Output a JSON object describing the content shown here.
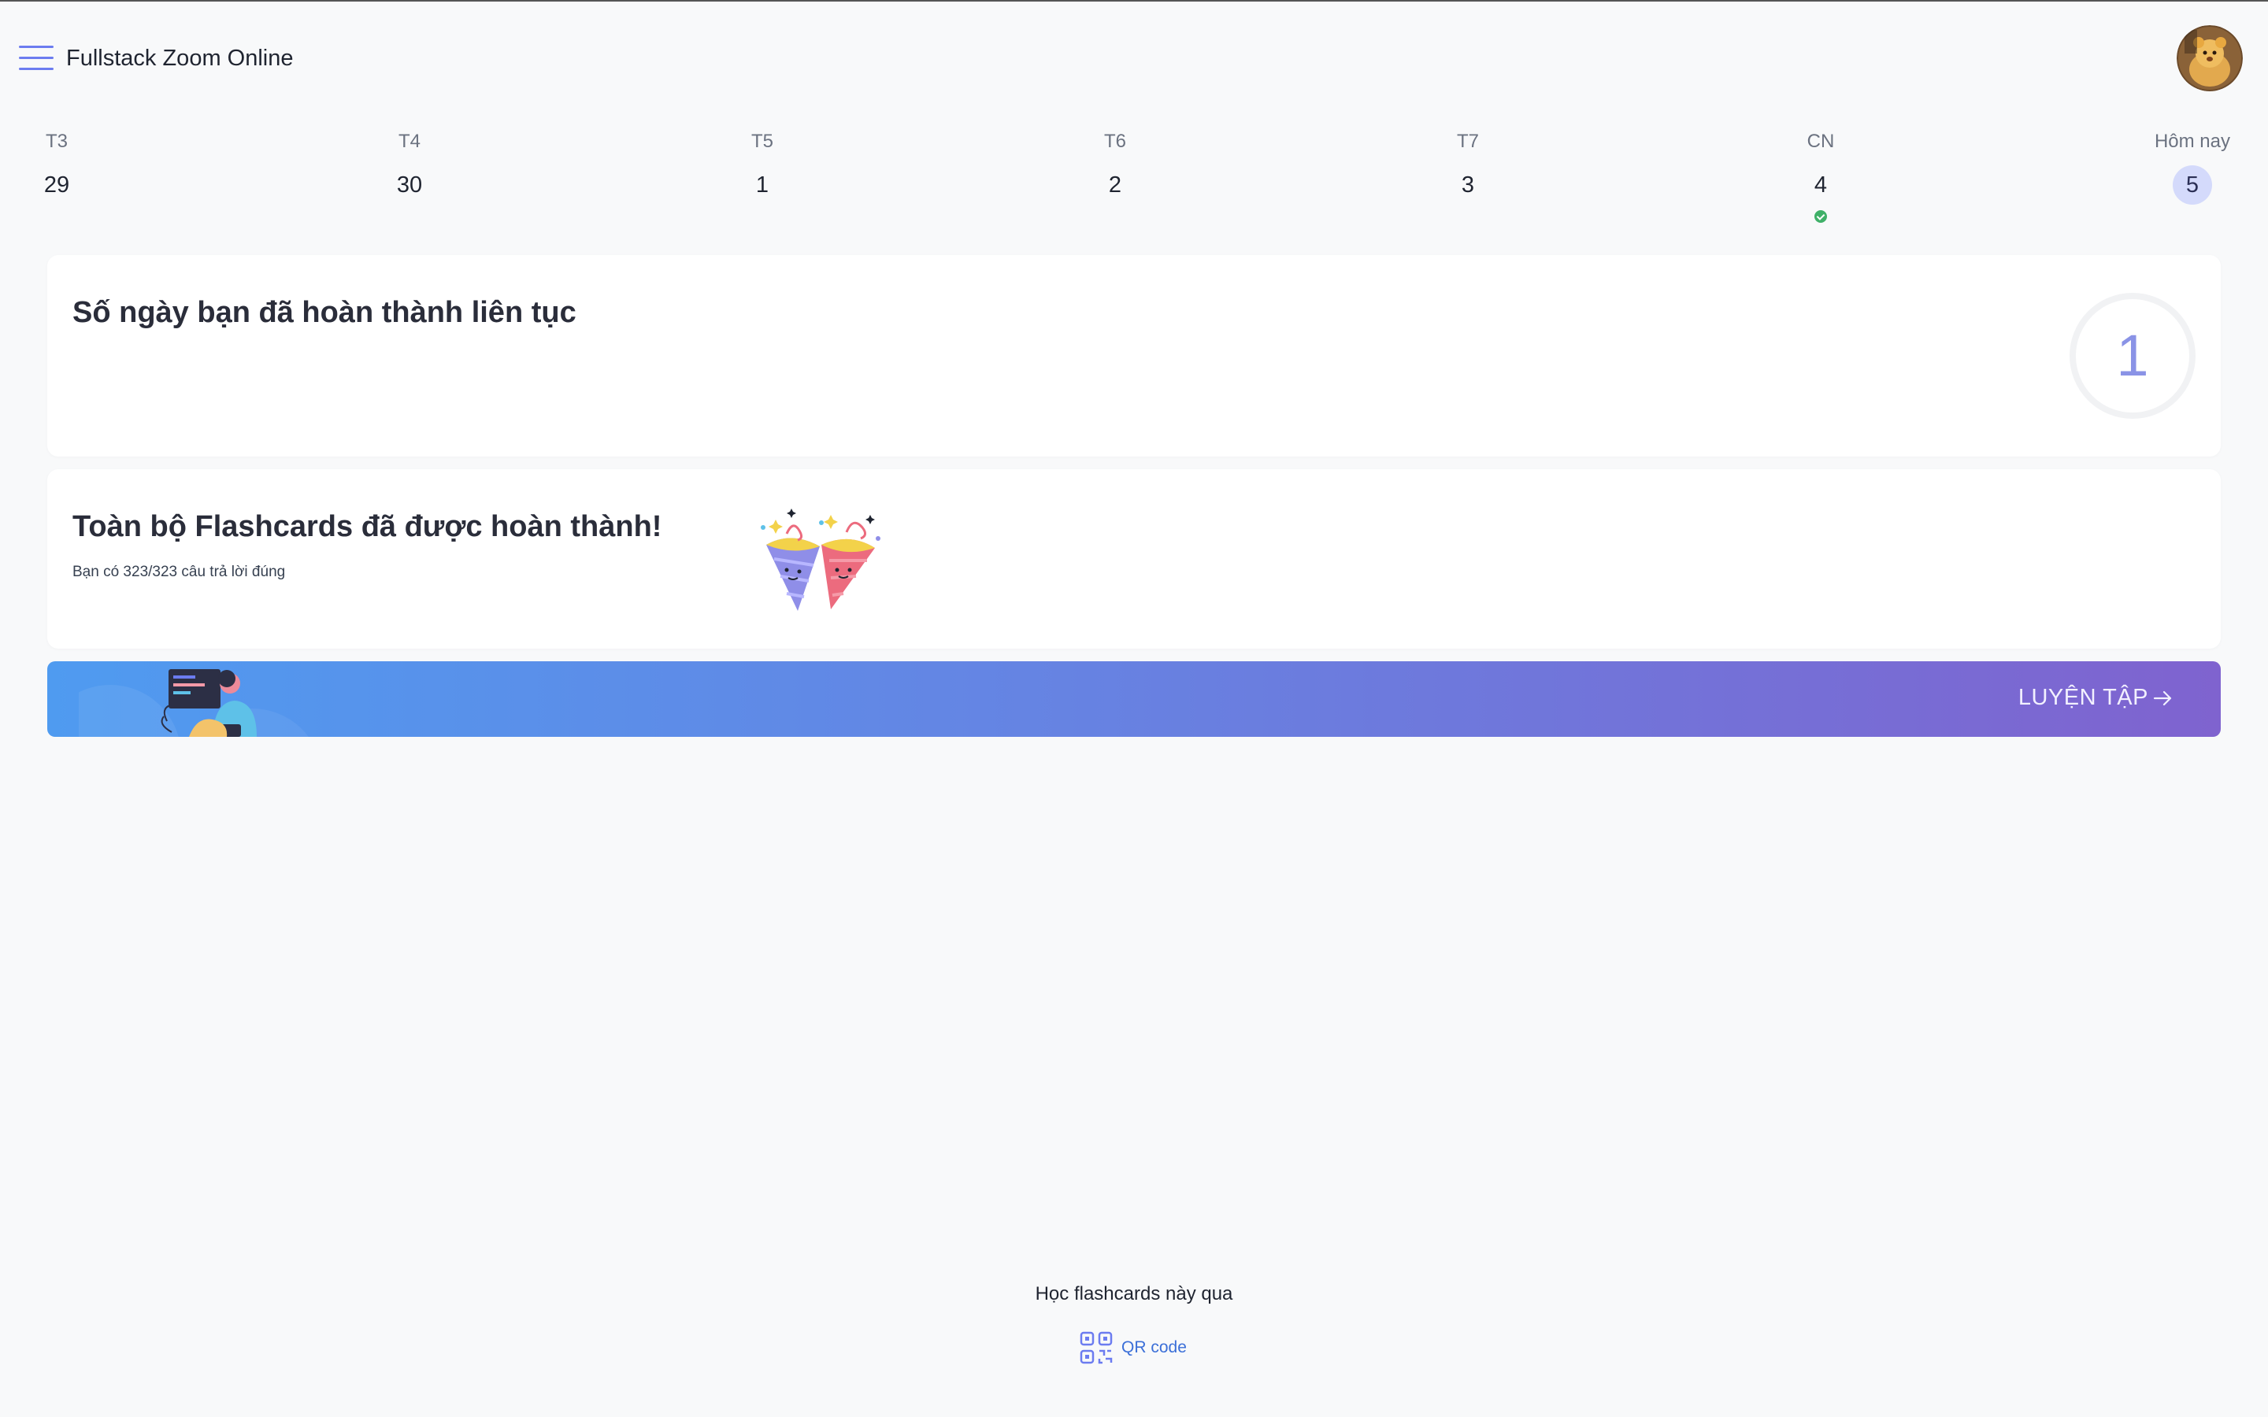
{
  "header": {
    "app_title": "Fullstack Zoom Online"
  },
  "week": [
    {
      "label": "T3",
      "date": "29",
      "done": false,
      "today": false
    },
    {
      "label": "T4",
      "date": "30",
      "done": false,
      "today": false
    },
    {
      "label": "T5",
      "date": "1",
      "done": false,
      "today": false
    },
    {
      "label": "T6",
      "date": "2",
      "done": false,
      "today": false
    },
    {
      "label": "T7",
      "date": "3",
      "done": false,
      "today": false
    },
    {
      "label": "CN",
      "date": "4",
      "done": true,
      "today": false
    },
    {
      "label": "Hôm nay",
      "date": "5",
      "done": false,
      "today": true
    }
  ],
  "streak": {
    "title": "Số ngày bạn đã hoàn thành liên tục",
    "count": "1"
  },
  "completion": {
    "title": "Toàn bộ Flashcards đã được hoàn thành!",
    "subtitle": "Bạn có 323/323 câu trả lời đúng"
  },
  "practice": {
    "label": "LUYỆN TẬP",
    "arrow_icon": "arrow-right-icon"
  },
  "footer": {
    "text": "Học flashcards này qua",
    "qr_label": "QR code",
    "qr_icon": "qr-code-icon"
  },
  "colors": {
    "accent": "#6c7cf0",
    "today_bg": "#d4dafb",
    "done_dot": "#3fb068",
    "gradient_start": "#4f9bf0",
    "gradient_end": "#7f63cf",
    "link": "#3b6fd8"
  }
}
